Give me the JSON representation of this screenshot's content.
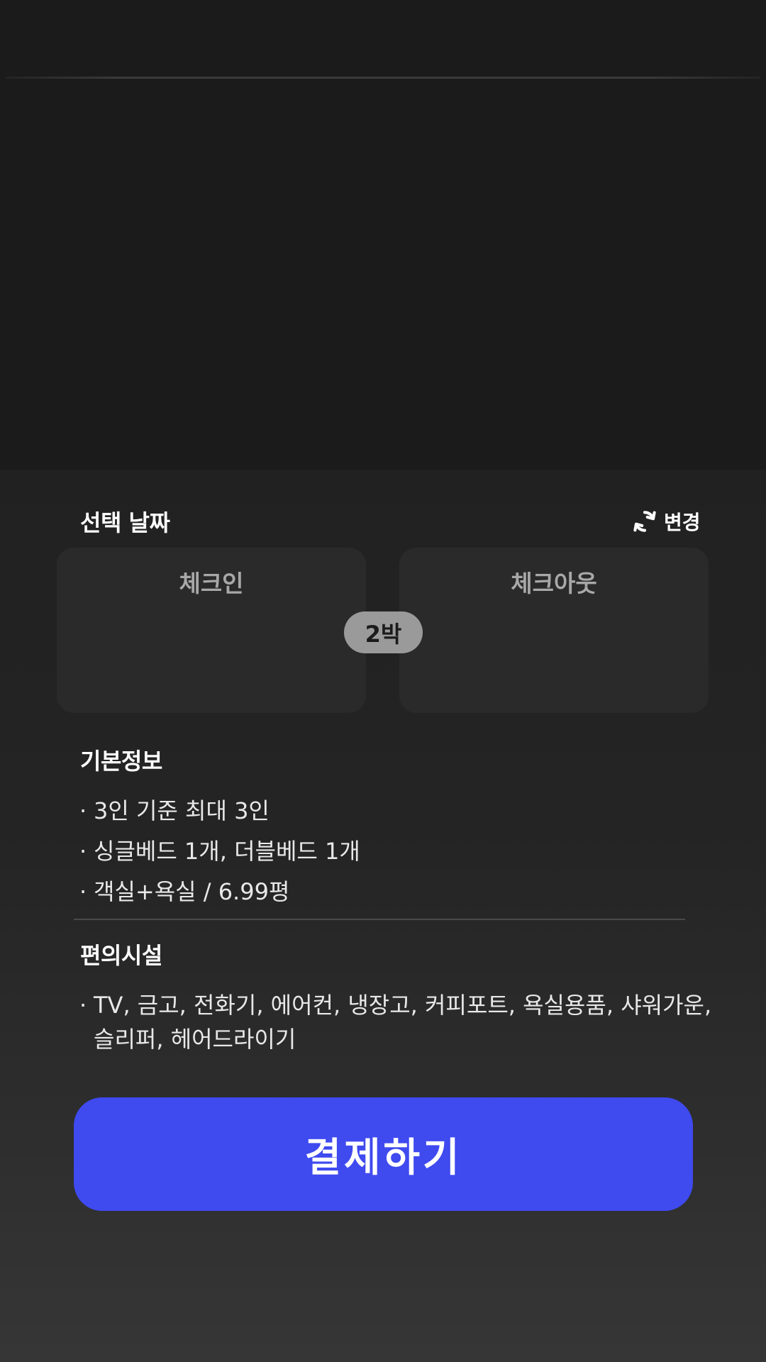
{
  "dates": {
    "title": "선택 날짜",
    "change_label": "변경",
    "checkin_label": "체크인",
    "checkout_label": "체크아웃",
    "nights": "2박"
  },
  "basic_info": {
    "title": "기본정보",
    "items": [
      "3인 기준 최대 3인",
      "싱글베드 1개, 더블베드 1개",
      "객실+욕실 / 6.99평"
    ]
  },
  "amenities": {
    "title": "편의시설",
    "lines": [
      "TV, 금고, 전화기, 에어컨, 냉장고, 커피포트, 욕실용품, 샤워가운,",
      "슬리퍼, 헤어드라이기"
    ]
  },
  "pay_button": {
    "label": "결제하기"
  },
  "colors": {
    "accent": "#3f4aef",
    "background": "#1b1b1b",
    "card": "#2a2a2a"
  }
}
